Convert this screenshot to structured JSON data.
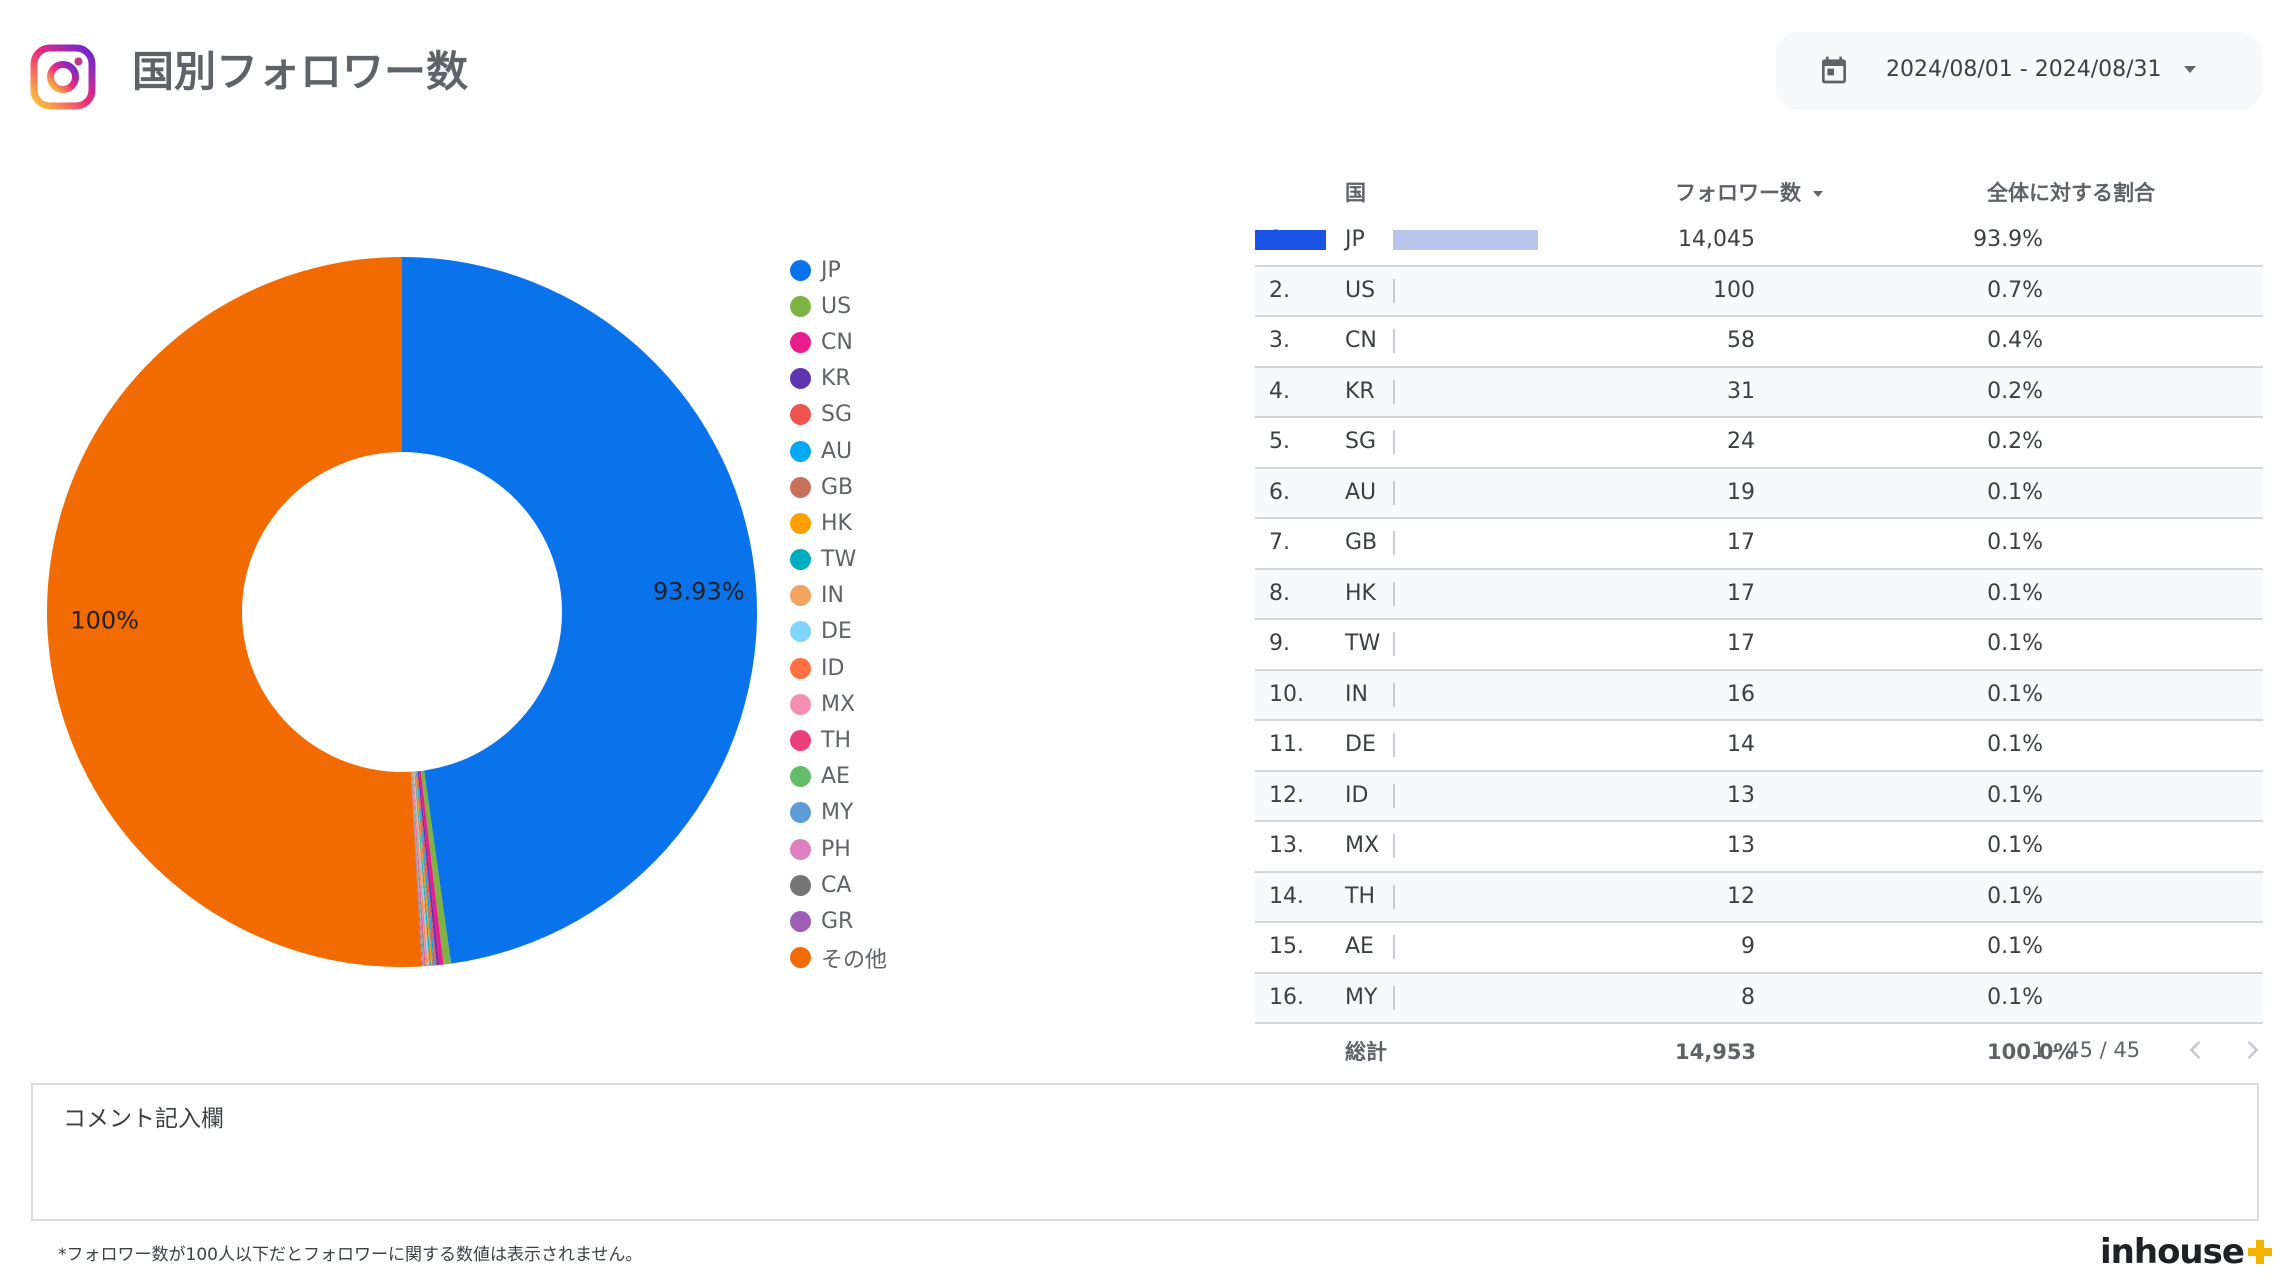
{
  "header": {
    "title": "国別フォロワー数",
    "date_range": "2024/08/01 - 2024/08/31"
  },
  "colors": {
    "instagram_gradient": [
      "#f9ce34",
      "#ee2a7b",
      "#6228d7"
    ],
    "bar_followers": "#1a53e6",
    "bar_share": "#b8c6eb"
  },
  "chart_data": {
    "type": "pie",
    "donut": true,
    "slices": [
      {
        "label": "JP",
        "value": 14045,
        "color": "#0a73eb"
      },
      {
        "label": "US",
        "value": 100,
        "color": "#7cb342"
      },
      {
        "label": "CN",
        "value": 58,
        "color": "#e91e8c"
      },
      {
        "label": "KR",
        "value": 31,
        "color": "#5e35b1"
      },
      {
        "label": "SG",
        "value": 24,
        "color": "#ef5350"
      },
      {
        "label": "AU",
        "value": 19,
        "color": "#03a9f4"
      },
      {
        "label": "GB",
        "value": 17,
        "color": "#c8705a"
      },
      {
        "label": "HK",
        "value": 17,
        "color": "#ffa000"
      },
      {
        "label": "TW",
        "value": 17,
        "color": "#00acc1"
      },
      {
        "label": "IN",
        "value": 16,
        "color": "#f4a460"
      },
      {
        "label": "DE",
        "value": 14,
        "color": "#81d4fa"
      },
      {
        "label": "ID",
        "value": 13,
        "color": "#ff7043"
      },
      {
        "label": "MX",
        "value": 13,
        "color": "#f48fb1"
      },
      {
        "label": "TH",
        "value": 12,
        "color": "#ec407a"
      },
      {
        "label": "AE",
        "value": 9,
        "color": "#66bb6a"
      },
      {
        "label": "MY",
        "value": 8,
        "color": "#5c9bd6"
      },
      {
        "label": "PH",
        "value": 7,
        "color": "#de7fc0"
      },
      {
        "label": "CA",
        "value": 7,
        "color": "#757575"
      },
      {
        "label": "GR",
        "value": 6,
        "color": "#9c5fb5"
      },
      {
        "label": "その他",
        "value": 14953,
        "color": "#f26b02"
      }
    ],
    "slice_labels": [
      {
        "slice": "JP",
        "text": "93.93%"
      },
      {
        "slice": "その他",
        "text": "100%"
      }
    ],
    "legend_position": "right"
  },
  "table": {
    "headers": {
      "country": "国",
      "followers": "フォロワー数",
      "share": "全体に対する割合"
    },
    "rows": [
      {
        "idx": "1.",
        "country": "JP",
        "followers": "14,045",
        "f": 14045,
        "share": "93.9%",
        "s": 93.9
      },
      {
        "idx": "2.",
        "country": "US",
        "followers": "100",
        "f": 100,
        "share": "0.7%",
        "s": 0.7
      },
      {
        "idx": "3.",
        "country": "CN",
        "followers": "58",
        "f": 58,
        "share": "0.4%",
        "s": 0.4
      },
      {
        "idx": "4.",
        "country": "KR",
        "followers": "31",
        "f": 31,
        "share": "0.2%",
        "s": 0.2
      },
      {
        "idx": "5.",
        "country": "SG",
        "followers": "24",
        "f": 24,
        "share": "0.2%",
        "s": 0.2
      },
      {
        "idx": "6.",
        "country": "AU",
        "followers": "19",
        "f": 19,
        "share": "0.1%",
        "s": 0.1
      },
      {
        "idx": "7.",
        "country": "GB",
        "followers": "17",
        "f": 17,
        "share": "0.1%",
        "s": 0.1
      },
      {
        "idx": "8.",
        "country": "HK",
        "followers": "17",
        "f": 17,
        "share": "0.1%",
        "s": 0.1
      },
      {
        "idx": "9.",
        "country": "TW",
        "followers": "17",
        "f": 17,
        "share": "0.1%",
        "s": 0.1
      },
      {
        "idx": "10.",
        "country": "IN",
        "followers": "16",
        "f": 16,
        "share": "0.1%",
        "s": 0.1
      },
      {
        "idx": "11.",
        "country": "DE",
        "followers": "14",
        "f": 14,
        "share": "0.1%",
        "s": 0.1
      },
      {
        "idx": "12.",
        "country": "ID",
        "followers": "13",
        "f": 13,
        "share": "0.1%",
        "s": 0.1
      },
      {
        "idx": "13.",
        "country": "MX",
        "followers": "13",
        "f": 13,
        "share": "0.1%",
        "s": 0.1
      },
      {
        "idx": "14.",
        "country": "TH",
        "followers": "12",
        "f": 12,
        "share": "0.1%",
        "s": 0.1
      },
      {
        "idx": "15.",
        "country": "AE",
        "followers": "9",
        "f": 9,
        "share": "0.1%",
        "s": 0.1
      },
      {
        "idx": "16.",
        "country": "MY",
        "followers": "8",
        "f": 8,
        "share": "0.1%",
        "s": 0.1
      }
    ],
    "totals": {
      "label": "総計",
      "followers": "14,953",
      "share": "100.0%"
    },
    "pagination": "1 - 45 / 45"
  },
  "comment": {
    "label": "コメント記入欄"
  },
  "footnote": "*フォロワー数が100人以下だとフォロワーに関する数値は表示されません。",
  "brand": {
    "name": "inhouse",
    "accent": "#f5b400"
  }
}
